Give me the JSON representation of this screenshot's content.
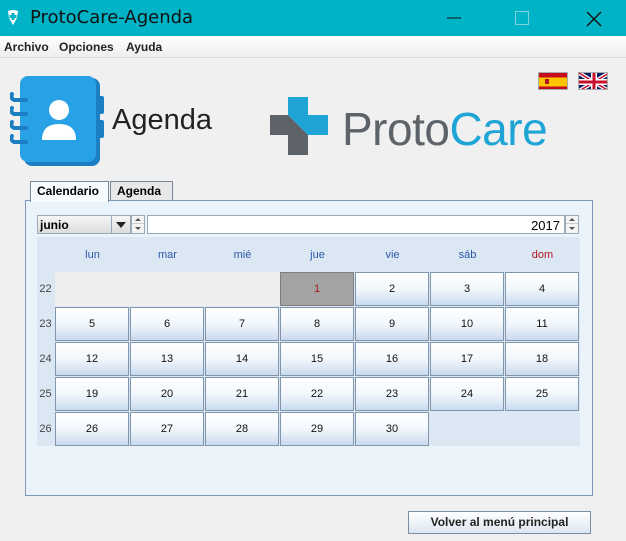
{
  "window": {
    "title": "ProtoCare-Agenda"
  },
  "menu": [
    "Archivo",
    "Opciones",
    "Ayuda"
  ],
  "header": {
    "agenda_label": "Agenda",
    "brand_proto": "Proto",
    "brand_care": "Care"
  },
  "tabs": [
    {
      "label": "Calendario",
      "active": true
    },
    {
      "label": "Agenda",
      "active": false
    }
  ],
  "calendar": {
    "month": "junio",
    "year": "2017",
    "day_headers": [
      "lun",
      "mar",
      "mié",
      "jue",
      "vie",
      "sáb",
      "dom"
    ],
    "weeks": [
      {
        "week": "22",
        "days": [
          "",
          "",
          "",
          "1",
          "2",
          "3",
          "4"
        ]
      },
      {
        "week": "23",
        "days": [
          "5",
          "6",
          "7",
          "8",
          "9",
          "10",
          "11"
        ]
      },
      {
        "week": "24",
        "days": [
          "12",
          "13",
          "14",
          "15",
          "16",
          "17",
          "18"
        ]
      },
      {
        "week": "25",
        "days": [
          "19",
          "20",
          "21",
          "22",
          "23",
          "24",
          "25"
        ]
      },
      {
        "week": "26",
        "days": [
          "26",
          "27",
          "28",
          "29",
          "30",
          "",
          ""
        ]
      }
    ],
    "selected_day": "1"
  },
  "buttons": {
    "back": "Volver al menú principal"
  },
  "colors": {
    "titlebar": "#00b3c7",
    "brand_blue": "#1fa4d6",
    "brand_gray": "#5d6368",
    "weekday_text": "#2c56a8",
    "sunday_text": "#b3141b"
  }
}
